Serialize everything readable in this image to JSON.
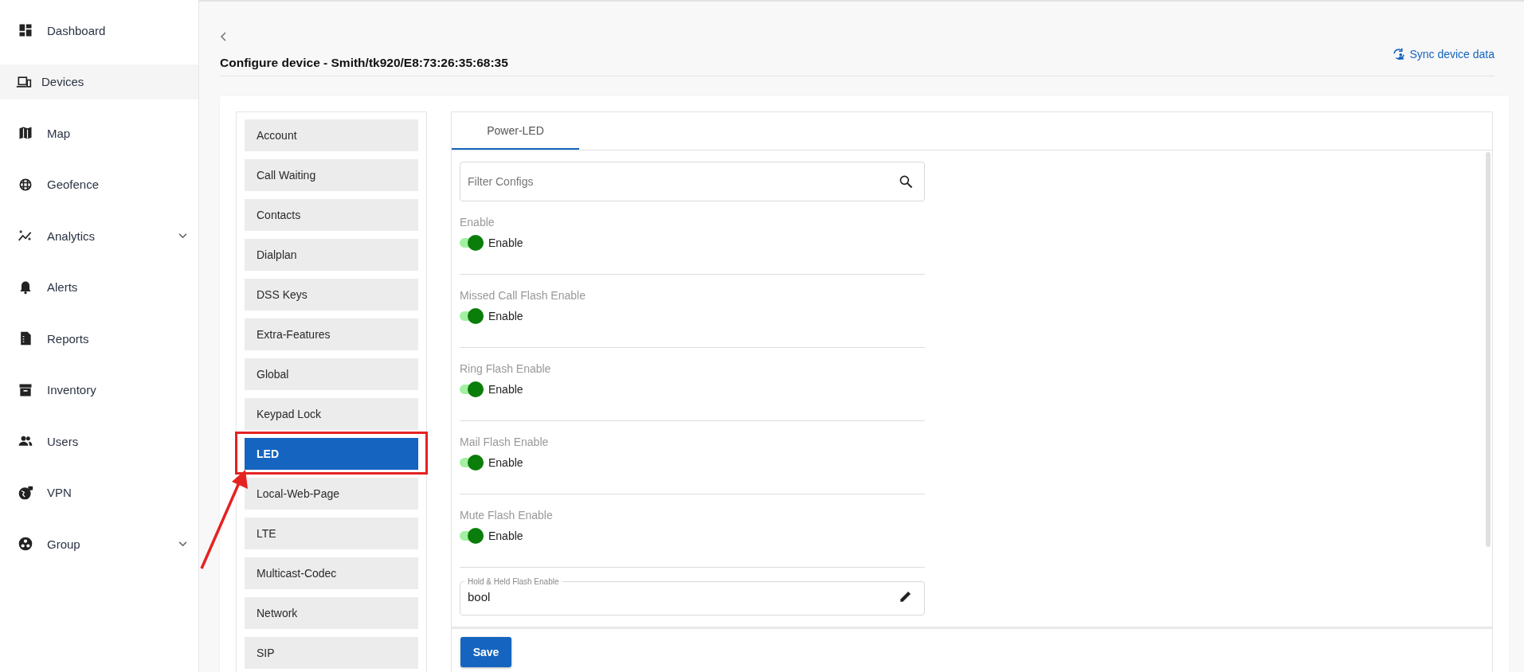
{
  "sidebar": {
    "items": [
      {
        "label": "Dashboard",
        "selected": false,
        "expandable": false
      },
      {
        "label": "Devices",
        "selected": true,
        "expandable": false
      },
      {
        "label": "Map",
        "selected": false,
        "expandable": false
      },
      {
        "label": "Geofence",
        "selected": false,
        "expandable": false
      },
      {
        "label": "Analytics",
        "selected": false,
        "expandable": true
      },
      {
        "label": "Alerts",
        "selected": false,
        "expandable": false
      },
      {
        "label": "Reports",
        "selected": false,
        "expandable": false
      },
      {
        "label": "Inventory",
        "selected": false,
        "expandable": false
      },
      {
        "label": "Users",
        "selected": false,
        "expandable": false
      },
      {
        "label": "VPN",
        "selected": false,
        "expandable": false
      },
      {
        "label": "Group",
        "selected": false,
        "expandable": true
      }
    ]
  },
  "header": {
    "title": "Configure device - Smith/tk920/E8:73:26:35:68:35",
    "sync_link": "Sync device data"
  },
  "categories": [
    {
      "label": "Account",
      "selected": false,
      "highlighted": false
    },
    {
      "label": "Call Waiting",
      "selected": false,
      "highlighted": false
    },
    {
      "label": "Contacts",
      "selected": false,
      "highlighted": false
    },
    {
      "label": "Dialplan",
      "selected": false,
      "highlighted": false
    },
    {
      "label": "DSS Keys",
      "selected": false,
      "highlighted": false
    },
    {
      "label": "Extra-Features",
      "selected": false,
      "highlighted": false
    },
    {
      "label": "Global",
      "selected": false,
      "highlighted": false
    },
    {
      "label": "Keypad Lock",
      "selected": false,
      "highlighted": false
    },
    {
      "label": "LED",
      "selected": true,
      "highlighted": true
    },
    {
      "label": "Local-Web-Page",
      "selected": false,
      "highlighted": false
    },
    {
      "label": "LTE",
      "selected": false,
      "highlighted": false
    },
    {
      "label": "Multicast-Codec",
      "selected": false,
      "highlighted": false
    },
    {
      "label": "Network",
      "selected": false,
      "highlighted": false
    },
    {
      "label": "SIP",
      "selected": false,
      "highlighted": false
    }
  ],
  "tabs": [
    {
      "label": "Power-LED",
      "selected": true
    }
  ],
  "filter": {
    "placeholder": "Filter Configs"
  },
  "settings": [
    {
      "kind": "toggle",
      "label": "Enable",
      "on": true,
      "toggle_label": "Enable"
    },
    {
      "kind": "toggle",
      "label": "Missed Call Flash Enable",
      "on": true,
      "toggle_label": "Enable"
    },
    {
      "kind": "toggle",
      "label": "Ring Flash Enable",
      "on": true,
      "toggle_label": "Enable"
    },
    {
      "kind": "toggle",
      "label": "Mail Flash Enable",
      "on": true,
      "toggle_label": "Enable"
    },
    {
      "kind": "toggle",
      "label": "Mute Flash Enable",
      "on": true,
      "toggle_label": "Enable"
    },
    {
      "kind": "field",
      "label": "Hold & Held Flash Enable",
      "value": "bool"
    }
  ],
  "save_button": "Save"
}
